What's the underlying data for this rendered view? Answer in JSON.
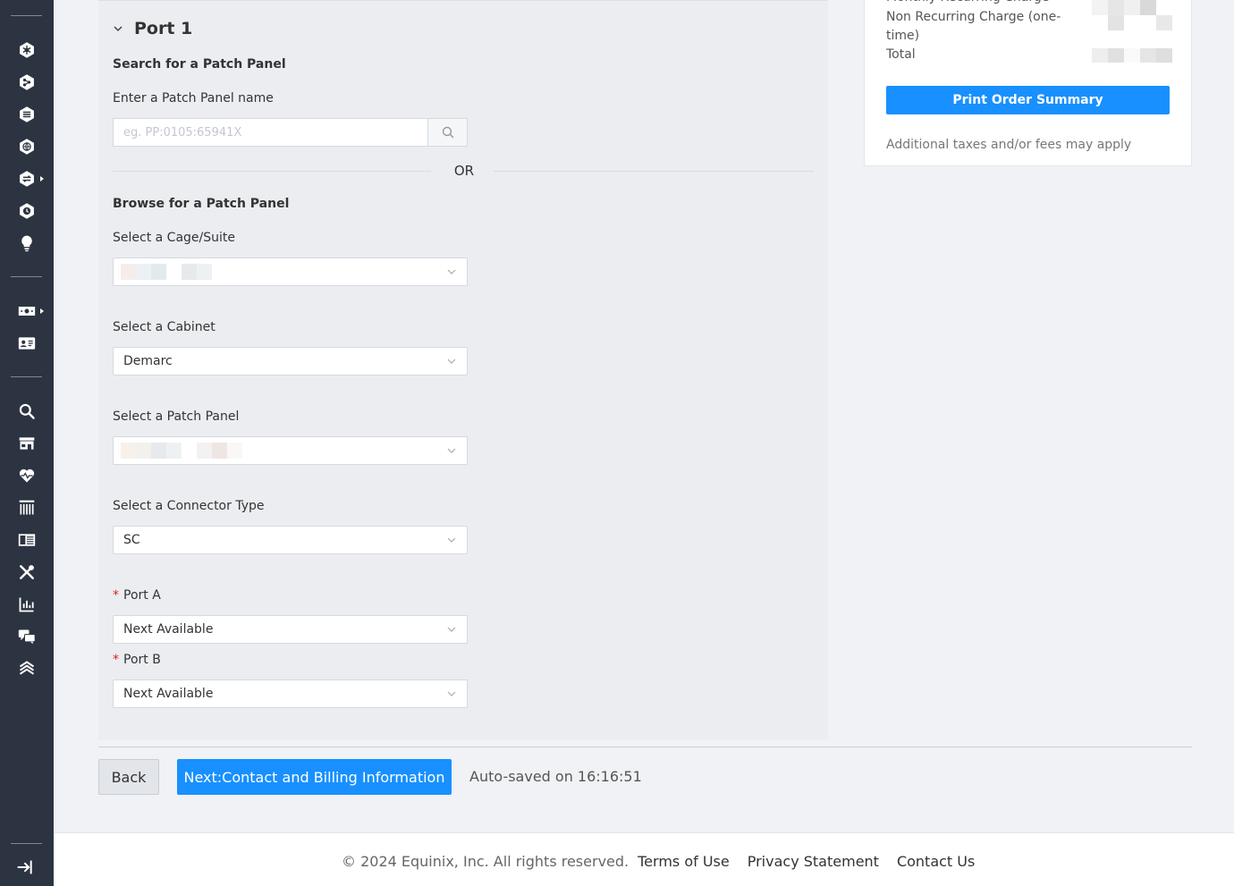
{
  "port": {
    "title": "Port 1",
    "search_heading": "Search for a Patch Panel",
    "search_label": "Enter a Patch Panel name",
    "search_placeholder": "eg. PP:0105:65941X",
    "or_text": "OR",
    "browse_heading": "Browse for a Patch Panel",
    "cage_label": "Select a Cage/Suite",
    "cabinet_label": "Select a Cabinet",
    "cabinet_value": "Demarc",
    "patch_panel_label": "Select a Patch Panel",
    "connector_label": "Select a Connector Type",
    "connector_value": "SC",
    "port_a_label": "Port A",
    "port_a_value": "Next Available",
    "port_b_label": "Port B",
    "port_b_value": "Next Available",
    "required_mark": "*"
  },
  "summary": {
    "mrc_label": "Monthly Recurring Charge",
    "nrc_label_line1": "Non Recurring Charge (one-",
    "nrc_label_line2": "time)",
    "total_label": "Total",
    "print_button": "Print Order Summary",
    "note": "Additional taxes and/or fees may apply"
  },
  "actions": {
    "back": "Back",
    "next": "Next:Contact and Billing Information",
    "autosave": "Auto-saved on 16:16:51"
  },
  "footer": {
    "copyright": "© 2024 Equinix, Inc. All rights reserved.",
    "terms": "Terms of Use",
    "privacy": "Privacy Statement",
    "contact": "Contact Us"
  },
  "colors": {
    "sidebar_bg": "#2c3441",
    "primary": "#1890ff",
    "required": "#e02020"
  },
  "icons": {
    "sidebar": [
      "network-hex-icon",
      "connection-hex-icon",
      "stack-hex-icon",
      "globe-hex-icon",
      "exchange-hex-icon",
      "clock-icon",
      "lightbulb-icon",
      "billing-icon",
      "id-card-icon",
      "search-icon",
      "store-icon",
      "health-icon",
      "columns-icon",
      "catalog-icon",
      "tools-icon",
      "chart-icon",
      "chat-icon",
      "layers-icon",
      "logout-icon"
    ]
  }
}
